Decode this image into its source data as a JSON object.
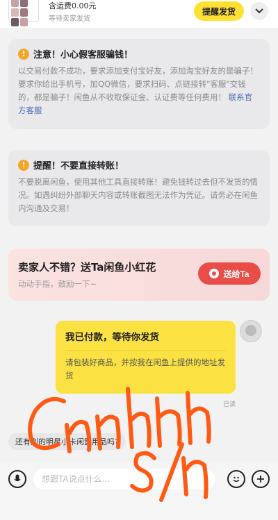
{
  "order": {
    "price_line": "含运费0.00元",
    "status": "等待卖家发货",
    "remind_button": "提醒发货"
  },
  "notice_scam": {
    "title": "注意！小心假客服骗钱！",
    "body": "以交易付款不成功，要求添加支付宝好友，添加淘宝好友的是骗子！要求你给出手机号，加QQ微信，要求扫码、点链接转\"客服\"交钱的，都是骗子！闲鱼从不收取保证金、认证费等任何费用！",
    "link": "联系官方客服"
  },
  "notice_transfer": {
    "title": "提醒！不要直接转账！",
    "body": "不要脱离闲鱼，使用其他工具直接转账！避免钱转过去但不发货的情况。如遇纠纷外部聊天内容或转账截图无法作为凭证。请务必在闲鱼内沟通及交易！"
  },
  "flower_card": {
    "title": "卖家人不错？送Ta闲鱼小红花",
    "subtitle": "动动手指，鼓励一下~",
    "button": "送给Ta"
  },
  "message": {
    "title": "我已付款，等待你发货",
    "body": "请包装好商品，并按我在闲鱼上提供的地址发货",
    "read_status": "已读"
  },
  "suggestion": {
    "text": "还有别的明星小卡闲置用品吗?"
  },
  "input": {
    "placeholder": "想跟TA说点什么..."
  },
  "colors": {
    "brand_yellow": "#ffe033",
    "bubble_yellow": "#fbe242",
    "send_red": "#e84d48",
    "scribble_orange": "#ff5a14"
  }
}
